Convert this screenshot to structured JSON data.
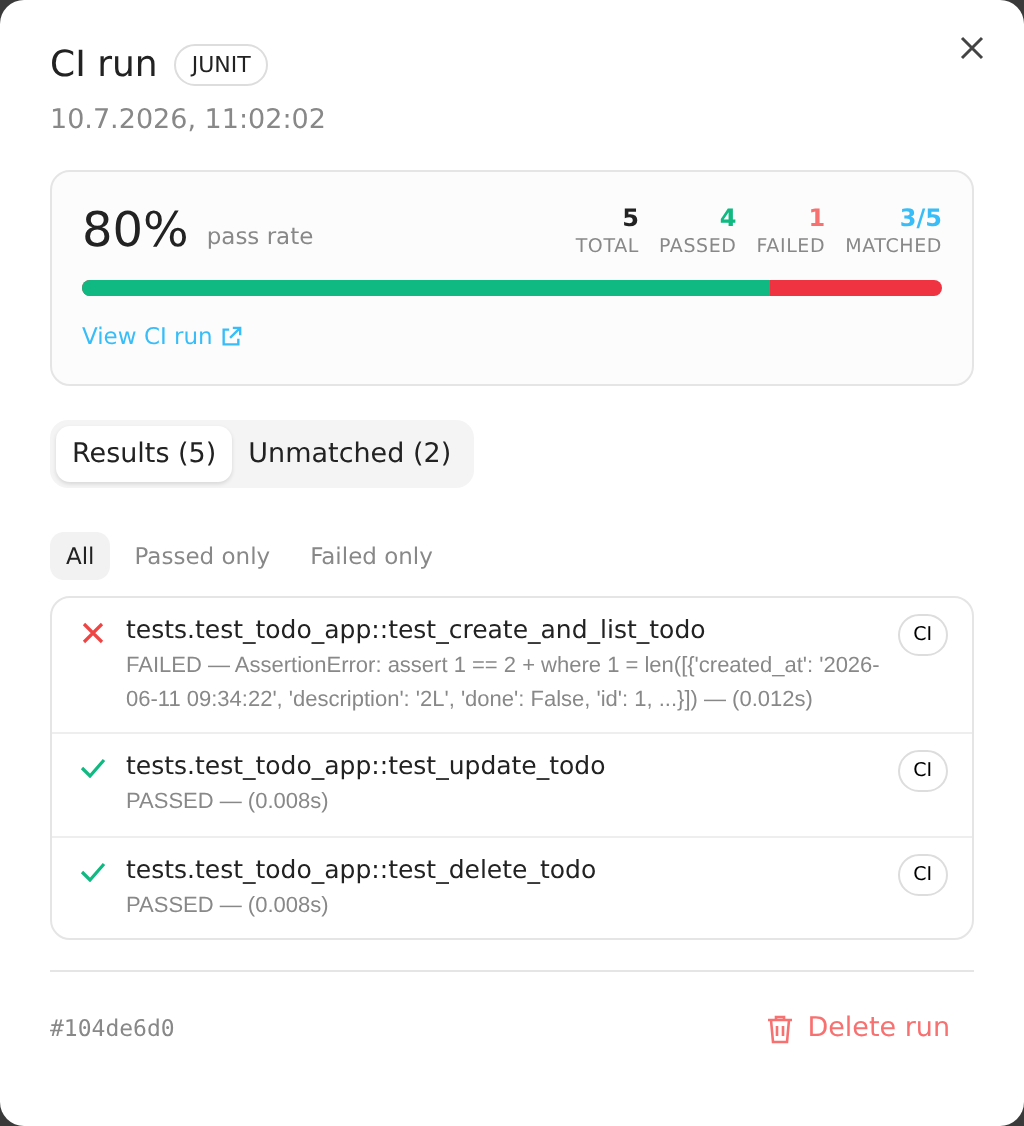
{
  "title": "CI run",
  "badge": "JUNIT",
  "timestamp": "10.7.2026, 11:02:02",
  "summary": {
    "rate": "80%",
    "rate_label": "pass rate",
    "stats": [
      {
        "value": "5",
        "label": "TOTAL",
        "color": "#222222"
      },
      {
        "value": "4",
        "label": "PASSED",
        "color": "#10b981"
      },
      {
        "value": "1",
        "label": "FAILED",
        "color": "#f87171"
      },
      {
        "value": "3/5",
        "label": "MATCHED",
        "color": "#38bdf8"
      }
    ],
    "bar": {
      "level": 0.8
    },
    "link": "View CI run"
  },
  "tabs": [
    {
      "label": "Results (5)",
      "selected": true
    },
    {
      "label": "Unmatched (2)",
      "selected": false
    }
  ],
  "filters": [
    {
      "label": "All",
      "selected": true
    },
    {
      "label": "Passed only",
      "selected": false
    },
    {
      "label": "Failed only",
      "selected": false
    }
  ],
  "results": [
    {
      "kind": "failed",
      "name": "tests.test_todo_app::test_create_and_list_todo",
      "detail": "FAILED — AssertionError: assert 1 == 2 + where 1 = len([{'created_at': '2026-06-11 09:34:22', 'description': '2L', 'done': False, 'id': 1, ...}]) — (0.012s)",
      "tag": "CI"
    },
    {
      "kind": "passed",
      "name": "tests.test_todo_app::test_update_todo",
      "detail": "PASSED — (0.008s)",
      "tag": "CI"
    },
    {
      "kind": "passed",
      "name": "tests.test_todo_app::test_delete_todo",
      "detail": "PASSED — (0.008s)",
      "tag": "CI"
    }
  ],
  "footer": {
    "hash": "#104de6d0",
    "delete": "Delete run"
  }
}
